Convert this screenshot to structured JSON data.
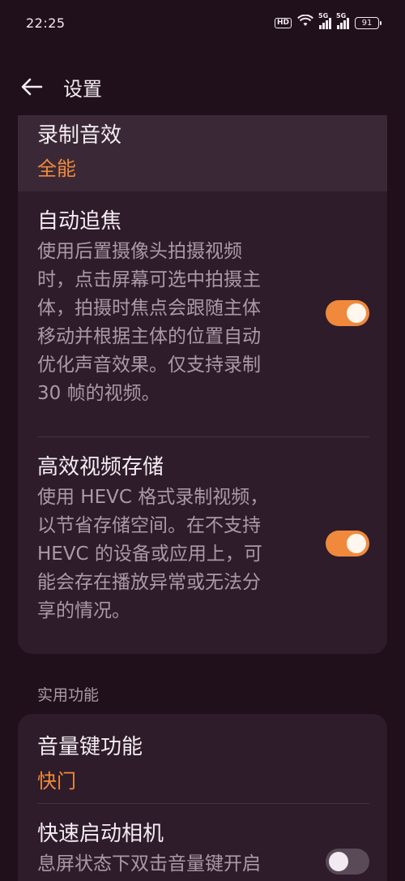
{
  "status_bar": {
    "time": "22:25",
    "hd": "HD",
    "signal1_label": "5G",
    "signal2_label": "5G",
    "battery": "91"
  },
  "header": {
    "title": "设置"
  },
  "recording_sound": {
    "title": "录制音效",
    "value": "全能"
  },
  "auto_focus": {
    "title": "自动追焦",
    "desc_lines": [
      "使用后置摄像头拍摄视频",
      "时，点击屏幕可选中拍摄主",
      "体，拍摄时焦点会跟随主体",
      "移动并根据主体的位置自动",
      "优化声音效果。仅支持录制",
      "30 帧的视频。"
    ],
    "enabled": true
  },
  "hevc": {
    "title": "高效视频存储",
    "desc_lines": [
      "使用 HEVC 格式录制视频，",
      "以节省存储空间。在不支持",
      "HEVC 的设备或应用上，可",
      "能会存在播放异常或无法分",
      "享的情况。"
    ],
    "enabled": true
  },
  "section_practical": "实用功能",
  "volume_key": {
    "title": "音量键功能",
    "value": "快门"
  },
  "quick_launch": {
    "title": "快速启动相机",
    "desc_lines": [
      "息屏状态下双击音量键开启"
    ],
    "enabled": false
  },
  "colors": {
    "accent": "#f0893c",
    "background": "#20101c",
    "card": "#2e1c2a"
  }
}
